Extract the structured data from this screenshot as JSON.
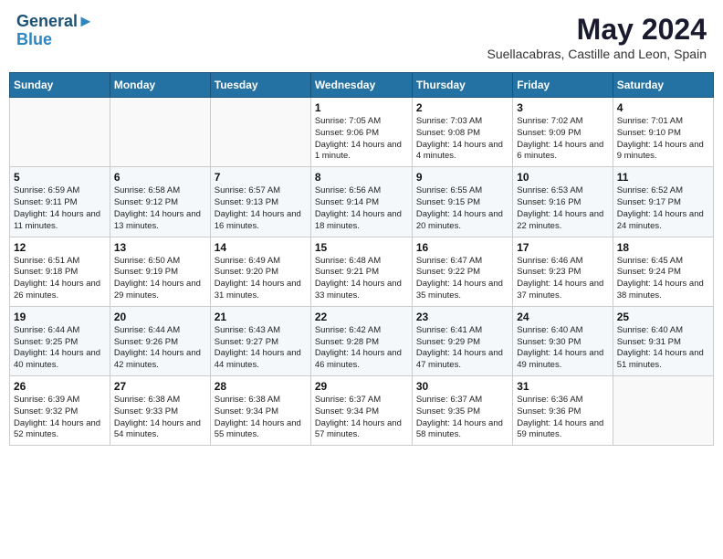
{
  "header": {
    "logo_line1": "General",
    "logo_line2": "Blue",
    "month": "May 2024",
    "location": "Suellacabras, Castille and Leon, Spain"
  },
  "weekdays": [
    "Sunday",
    "Monday",
    "Tuesday",
    "Wednesday",
    "Thursday",
    "Friday",
    "Saturday"
  ],
  "weeks": [
    [
      {
        "day": "",
        "info": ""
      },
      {
        "day": "",
        "info": ""
      },
      {
        "day": "",
        "info": ""
      },
      {
        "day": "1",
        "info": "Sunrise: 7:05 AM\nSunset: 9:06 PM\nDaylight: 14 hours and 1 minute."
      },
      {
        "day": "2",
        "info": "Sunrise: 7:03 AM\nSunset: 9:08 PM\nDaylight: 14 hours and 4 minutes."
      },
      {
        "day": "3",
        "info": "Sunrise: 7:02 AM\nSunset: 9:09 PM\nDaylight: 14 hours and 6 minutes."
      },
      {
        "day": "4",
        "info": "Sunrise: 7:01 AM\nSunset: 9:10 PM\nDaylight: 14 hours and 9 minutes."
      }
    ],
    [
      {
        "day": "5",
        "info": "Sunrise: 6:59 AM\nSunset: 9:11 PM\nDaylight: 14 hours and 11 minutes."
      },
      {
        "day": "6",
        "info": "Sunrise: 6:58 AM\nSunset: 9:12 PM\nDaylight: 14 hours and 13 minutes."
      },
      {
        "day": "7",
        "info": "Sunrise: 6:57 AM\nSunset: 9:13 PM\nDaylight: 14 hours and 16 minutes."
      },
      {
        "day": "8",
        "info": "Sunrise: 6:56 AM\nSunset: 9:14 PM\nDaylight: 14 hours and 18 minutes."
      },
      {
        "day": "9",
        "info": "Sunrise: 6:55 AM\nSunset: 9:15 PM\nDaylight: 14 hours and 20 minutes."
      },
      {
        "day": "10",
        "info": "Sunrise: 6:53 AM\nSunset: 9:16 PM\nDaylight: 14 hours and 22 minutes."
      },
      {
        "day": "11",
        "info": "Sunrise: 6:52 AM\nSunset: 9:17 PM\nDaylight: 14 hours and 24 minutes."
      }
    ],
    [
      {
        "day": "12",
        "info": "Sunrise: 6:51 AM\nSunset: 9:18 PM\nDaylight: 14 hours and 26 minutes."
      },
      {
        "day": "13",
        "info": "Sunrise: 6:50 AM\nSunset: 9:19 PM\nDaylight: 14 hours and 29 minutes."
      },
      {
        "day": "14",
        "info": "Sunrise: 6:49 AM\nSunset: 9:20 PM\nDaylight: 14 hours and 31 minutes."
      },
      {
        "day": "15",
        "info": "Sunrise: 6:48 AM\nSunset: 9:21 PM\nDaylight: 14 hours and 33 minutes."
      },
      {
        "day": "16",
        "info": "Sunrise: 6:47 AM\nSunset: 9:22 PM\nDaylight: 14 hours and 35 minutes."
      },
      {
        "day": "17",
        "info": "Sunrise: 6:46 AM\nSunset: 9:23 PM\nDaylight: 14 hours and 37 minutes."
      },
      {
        "day": "18",
        "info": "Sunrise: 6:45 AM\nSunset: 9:24 PM\nDaylight: 14 hours and 38 minutes."
      }
    ],
    [
      {
        "day": "19",
        "info": "Sunrise: 6:44 AM\nSunset: 9:25 PM\nDaylight: 14 hours and 40 minutes."
      },
      {
        "day": "20",
        "info": "Sunrise: 6:44 AM\nSunset: 9:26 PM\nDaylight: 14 hours and 42 minutes."
      },
      {
        "day": "21",
        "info": "Sunrise: 6:43 AM\nSunset: 9:27 PM\nDaylight: 14 hours and 44 minutes."
      },
      {
        "day": "22",
        "info": "Sunrise: 6:42 AM\nSunset: 9:28 PM\nDaylight: 14 hours and 46 minutes."
      },
      {
        "day": "23",
        "info": "Sunrise: 6:41 AM\nSunset: 9:29 PM\nDaylight: 14 hours and 47 minutes."
      },
      {
        "day": "24",
        "info": "Sunrise: 6:40 AM\nSunset: 9:30 PM\nDaylight: 14 hours and 49 minutes."
      },
      {
        "day": "25",
        "info": "Sunrise: 6:40 AM\nSunset: 9:31 PM\nDaylight: 14 hours and 51 minutes."
      }
    ],
    [
      {
        "day": "26",
        "info": "Sunrise: 6:39 AM\nSunset: 9:32 PM\nDaylight: 14 hours and 52 minutes."
      },
      {
        "day": "27",
        "info": "Sunrise: 6:38 AM\nSunset: 9:33 PM\nDaylight: 14 hours and 54 minutes."
      },
      {
        "day": "28",
        "info": "Sunrise: 6:38 AM\nSunset: 9:34 PM\nDaylight: 14 hours and 55 minutes."
      },
      {
        "day": "29",
        "info": "Sunrise: 6:37 AM\nSunset: 9:34 PM\nDaylight: 14 hours and 57 minutes."
      },
      {
        "day": "30",
        "info": "Sunrise: 6:37 AM\nSunset: 9:35 PM\nDaylight: 14 hours and 58 minutes."
      },
      {
        "day": "31",
        "info": "Sunrise: 6:36 AM\nSunset: 9:36 PM\nDaylight: 14 hours and 59 minutes."
      },
      {
        "day": "",
        "info": ""
      }
    ]
  ]
}
